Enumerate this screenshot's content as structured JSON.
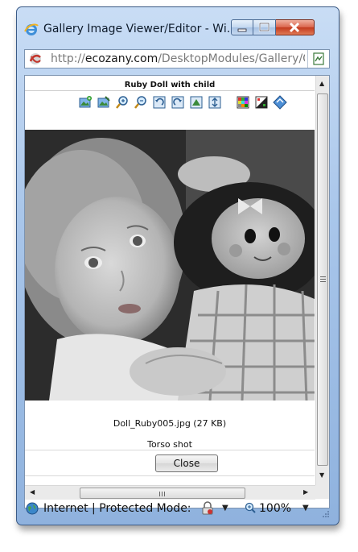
{
  "window": {
    "title": "Gallery Image Viewer/Editor - Wi...",
    "controls": {
      "minimize": "minimize",
      "maximize": "maximize",
      "close": "close"
    }
  },
  "address_bar": {
    "scheme": "http://",
    "host": "ecozany.com",
    "path": "/DesktopModules/Gallery/C"
  },
  "page": {
    "title": "Ruby Doll with child",
    "toolbar_icons": [
      "add-image-icon",
      "edit-image-icon",
      "zoom-in-icon",
      "zoom-out-icon",
      "rotate-left-icon",
      "rotate-right-icon",
      "flip-horizontal-icon",
      "flip-vertical-icon",
      "color-adjust-icon",
      "contrast-icon",
      "save-icon"
    ],
    "file_info": "Doll_Ruby005.jpg (27 KB)",
    "description": "Torso shot",
    "close_label": "Close"
  },
  "status_bar": {
    "zone_text": "Internet | Protected Mode: O",
    "zoom": "100%"
  }
}
